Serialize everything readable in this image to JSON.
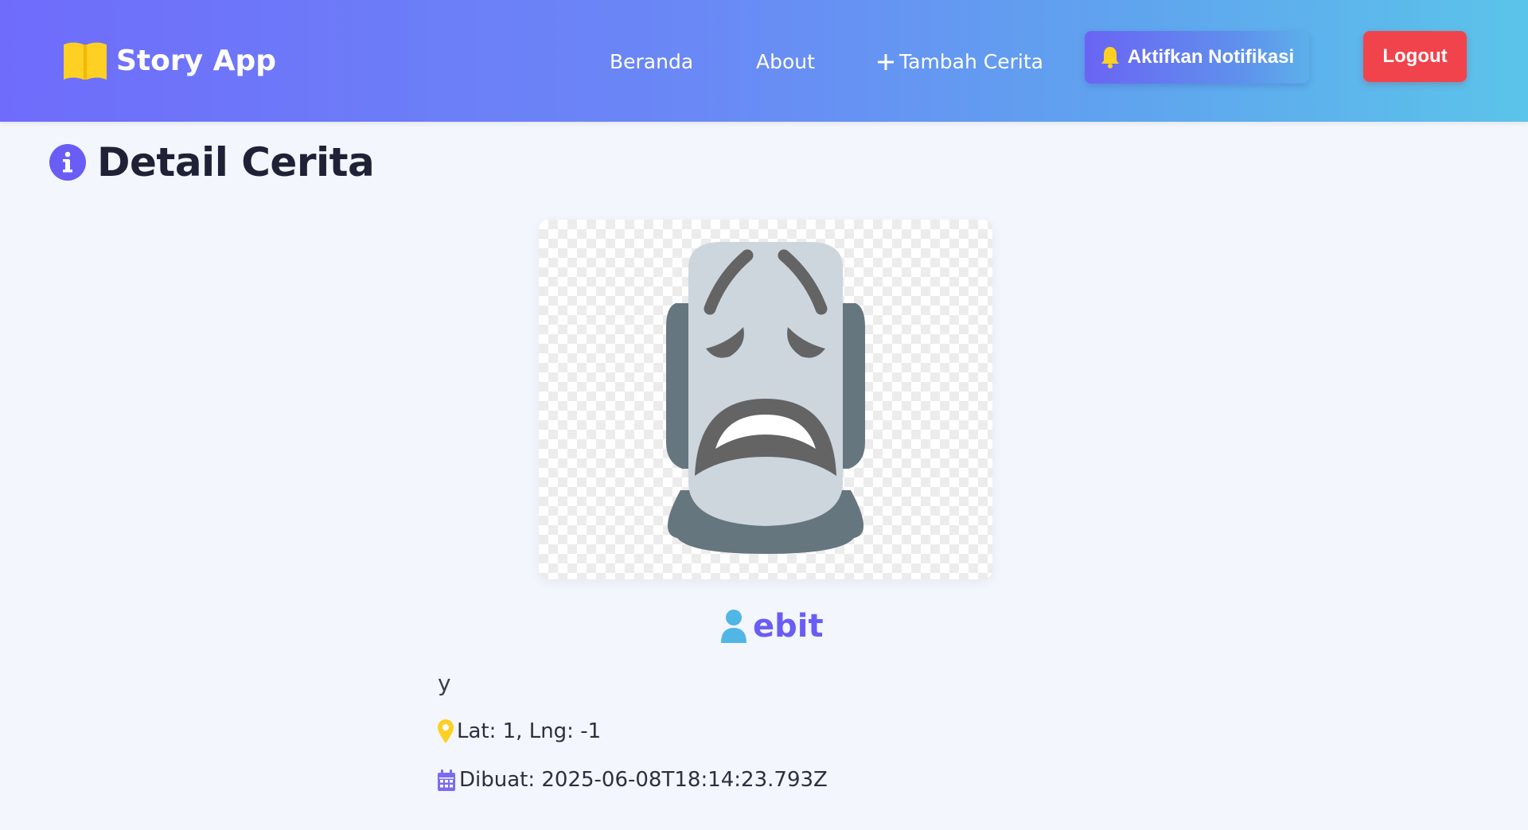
{
  "app": {
    "title": "Story App",
    "brand_icon": "book-icon"
  },
  "nav": {
    "items": [
      {
        "label": "Beranda"
      },
      {
        "label": "About"
      },
      {
        "label": "Tambah Cerita",
        "icon": "plus-icon"
      }
    ],
    "notification_button": {
      "label": "Aktifkan Notifikasi",
      "icon": "bell-icon"
    },
    "logout_button": {
      "label": "Logout"
    }
  },
  "page": {
    "title": "Detail Cerita",
    "title_icon": "info-icon"
  },
  "story": {
    "image_icon": "moai-face-emoji",
    "author": "ebit",
    "author_icon": "user-icon",
    "description": "y",
    "location_text": "Lat: 1, Lng: -1",
    "location_icon": "map-pin-icon",
    "created_text": "Dibuat: 2025-06-08T18:14:23.793Z",
    "created_icon": "calendar-icon"
  },
  "colors": {
    "navbar_start": "#6f6cfb",
    "navbar_end": "#5bc4ea",
    "accent": "#6a5df5",
    "logout": "#f1434b",
    "icon_yellow": "#fdd023",
    "user_icon": "#4fb6e6",
    "page_background": "#f3f6fd"
  }
}
